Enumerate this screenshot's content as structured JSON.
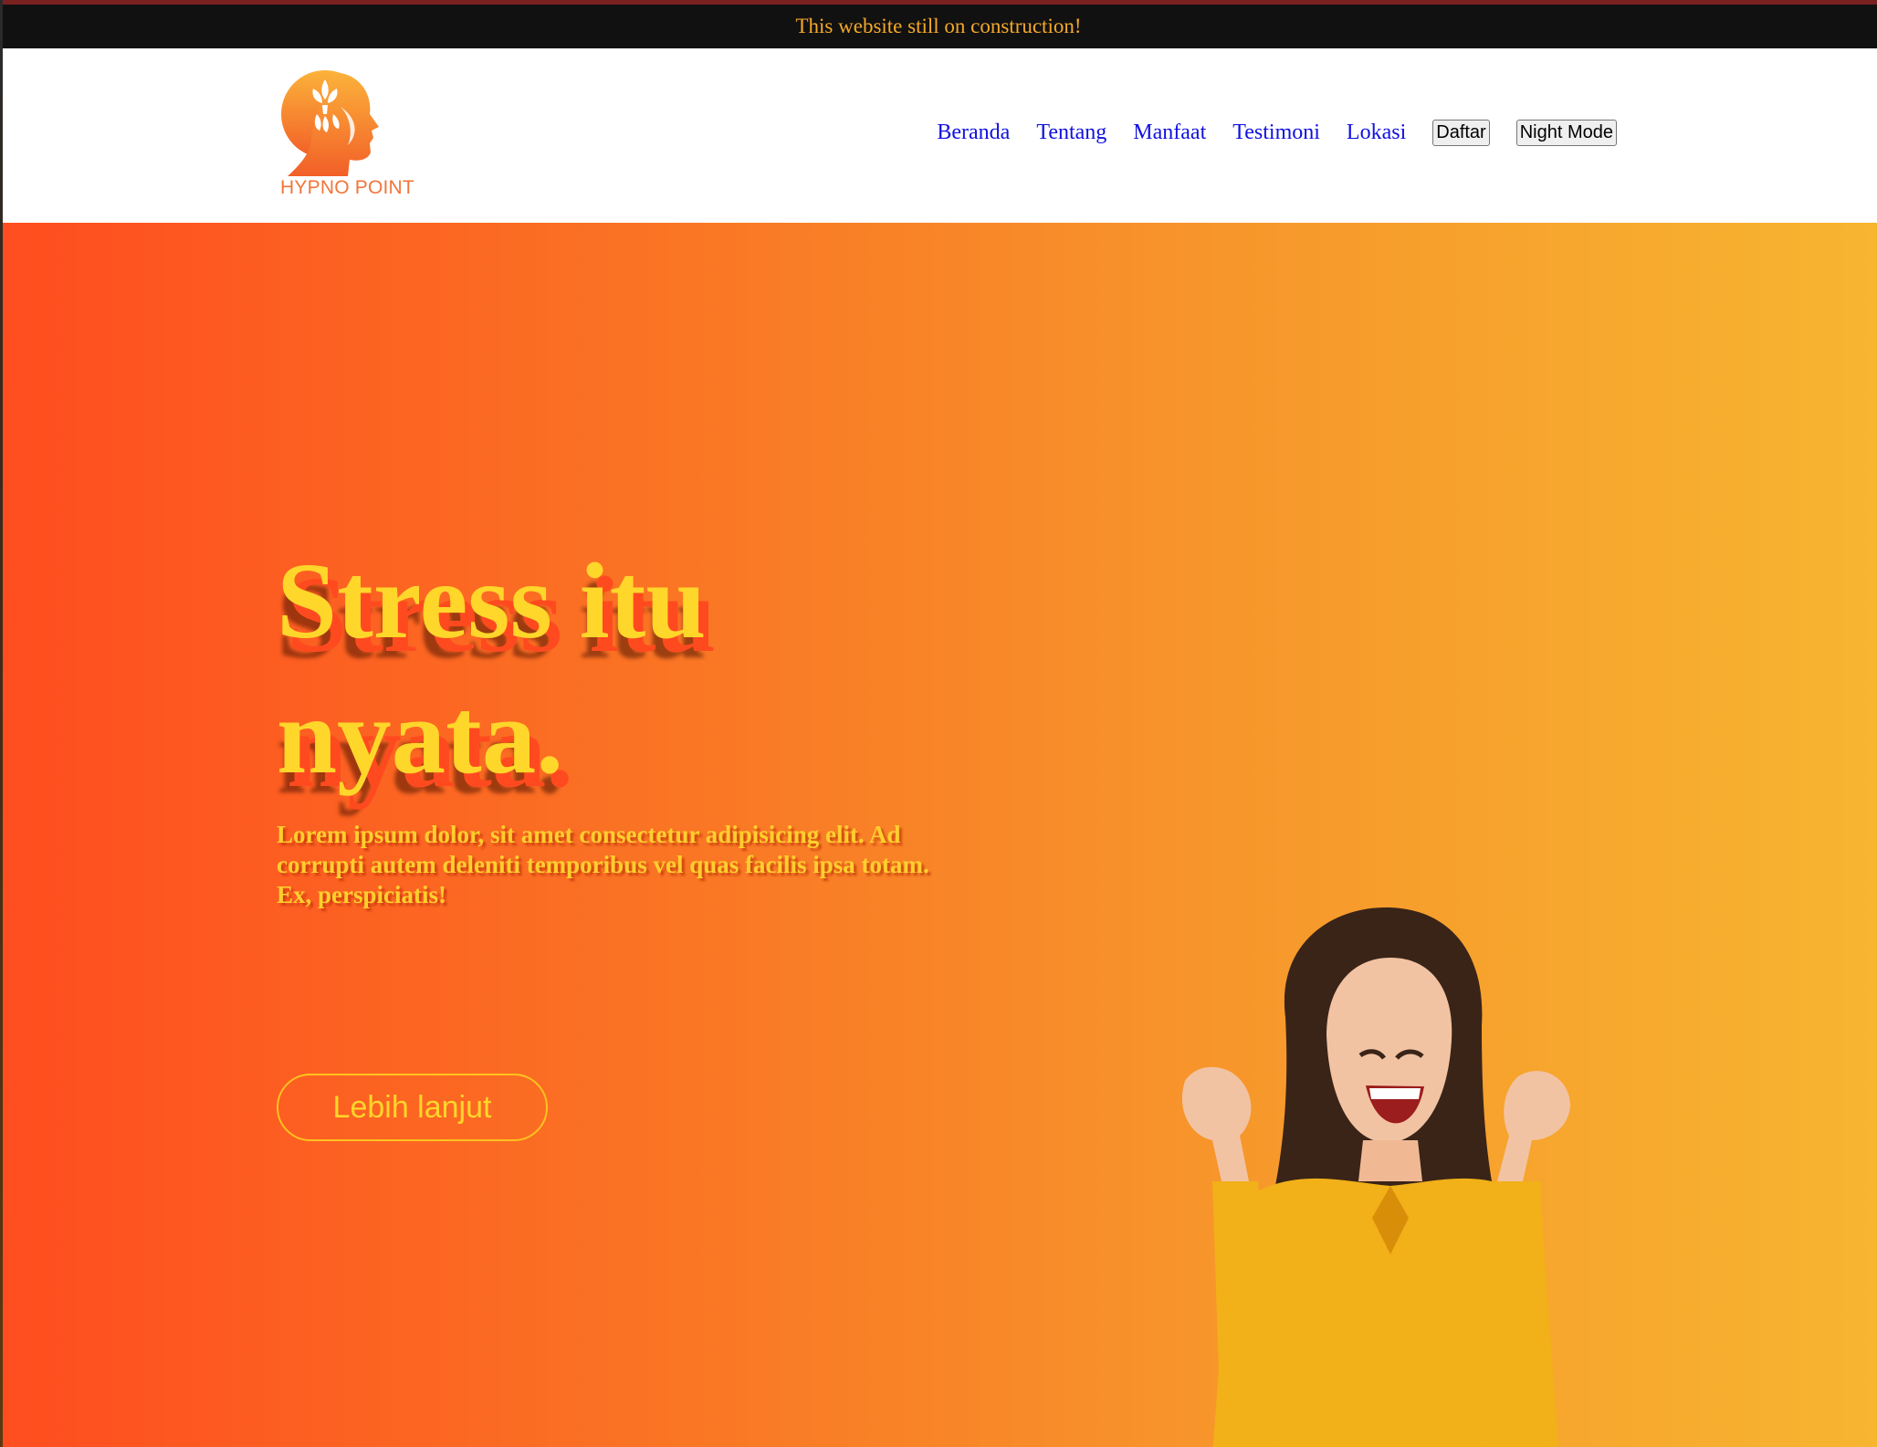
{
  "notice": {
    "text": "This website still on construction!"
  },
  "logo": {
    "name": "HYPNO POINT"
  },
  "nav": {
    "links": [
      "Beranda",
      "Tentang",
      "Manfaat",
      "Testimoni",
      "Lokasi"
    ],
    "register_label": "Daftar",
    "night_mode_label": "Night Mode"
  },
  "hero": {
    "title": "Stress itu nyata.",
    "description": "Lorem ipsum dolor, sit amet consectetur adipisicing elit. Ad corrupti autem deleniti temporibus vel quas facilis ipsa totam. Ex, perspiciatis!",
    "cta_label": "Lebih lanjut",
    "image_subject": "excited-woman-photo"
  },
  "colors": {
    "notice_bg": "#111111",
    "notice_text": "#f5a82a",
    "nav_link": "#1010e0",
    "hero_gradient_start": "#ff4d1f",
    "hero_gradient_end": "#f7b530",
    "hero_title": "#ffd62a",
    "logo_orange": "#f0763a"
  }
}
